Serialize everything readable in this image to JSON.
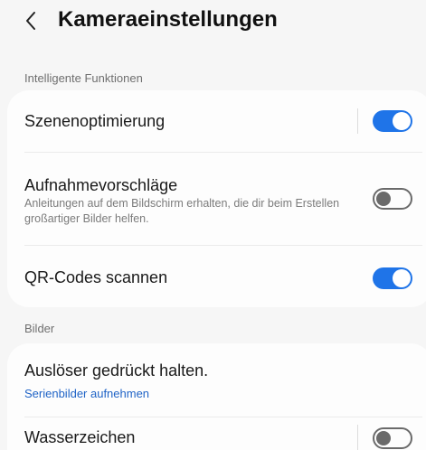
{
  "header": {
    "title": "Kameraeinstellungen",
    "back_icon": "chevron-left-icon"
  },
  "sections": [
    {
      "label": "Intelligente Funktionen",
      "items": [
        {
          "title": "Szenenoptimierung",
          "toggle": true
        },
        {
          "title": "Aufnahmevorschläge",
          "subtitle": "Anleitungen auf dem Bildschirm erhalten, die dir beim Erstellen großartiger Bilder helfen.",
          "toggle": false
        },
        {
          "title": "QR-Codes scannen",
          "toggle": true
        }
      ]
    },
    {
      "label": "Bilder",
      "items": [
        {
          "title": "Auslöser gedrückt halten.",
          "link": "Serienbilder aufnehmen"
        },
        {
          "title": "Wasserzeichen",
          "toggle": false
        }
      ]
    }
  ],
  "colors": {
    "accent": "#1f74e8",
    "link": "#1f63c6",
    "background": "#f6f6f6",
    "card": "#fdfdfd"
  }
}
